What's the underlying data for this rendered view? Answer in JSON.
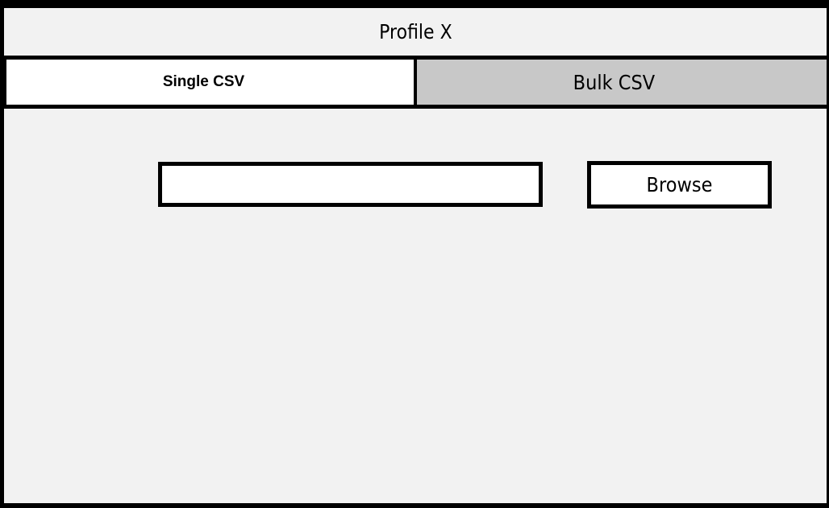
{
  "window": {
    "title": "Profile X"
  },
  "tabs": [
    {
      "label": "Single CSV",
      "selected": true
    },
    {
      "label": "Bulk CSV",
      "selected": false
    }
  ],
  "file_picker": {
    "value": "",
    "placeholder": "",
    "browse_label": "Browse"
  },
  "colors": {
    "background": "#f2f2f2",
    "border": "#000000",
    "active_tab": "#ffffff",
    "inactive_tab": "#c8c8c8"
  }
}
